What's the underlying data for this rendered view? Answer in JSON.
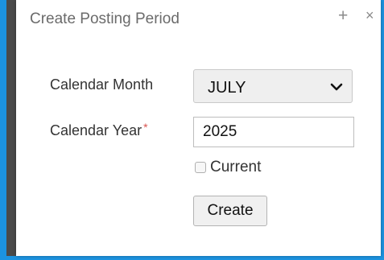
{
  "dialog": {
    "title": "Create Posting Period",
    "plus_icon": "+",
    "close_icon": "×"
  },
  "form": {
    "month_label": "Calendar Month",
    "month_value": "JULY",
    "year_label": "Calendar Year",
    "required_marker": "*",
    "year_value": "2025",
    "current_label": "Current",
    "current_checked": false,
    "create_button": "Create"
  }
}
